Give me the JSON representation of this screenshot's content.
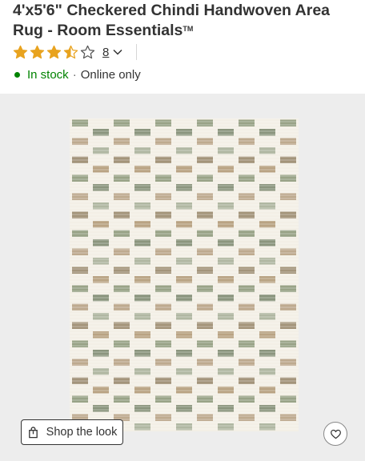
{
  "product": {
    "title": "4'x5'6\" Checkered Chindi Handwoven Area Rug - Room Essentials",
    "trademark": "TM"
  },
  "rating": {
    "value": 3.5,
    "out_of": 5,
    "review_count": "8"
  },
  "availability": {
    "status": "In stock",
    "separator": "·",
    "channel": "Online only"
  },
  "media": {
    "shop_the_look_label": "Shop the look"
  },
  "colors": {
    "accent_green": "#008300",
    "star_gold": "#e8a31f",
    "image_bg": "#ededed"
  },
  "icons": {
    "rating_star": "star-icon",
    "expand": "chevron-down-icon",
    "shop_the_look": "shopping-bag-icon",
    "favorite": "heart-icon"
  }
}
